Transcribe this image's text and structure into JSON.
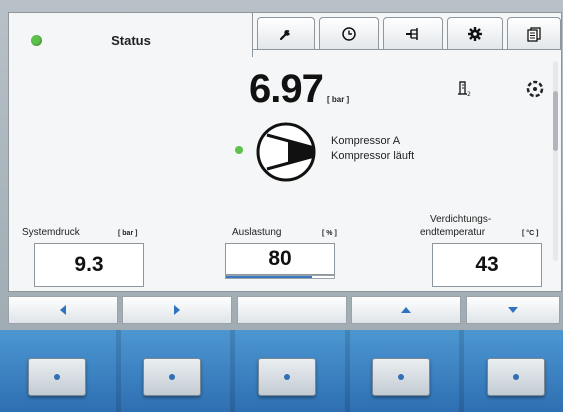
{
  "tabs": {
    "active": {
      "label": "Status",
      "indicator": "green-led"
    },
    "icons": [
      "wrench-icon",
      "clock-icon",
      "network-icon",
      "gear-icon",
      "documents-icon"
    ]
  },
  "main": {
    "pressure_value": "6.97",
    "pressure_unit": "[ bar ]",
    "compressor_name": "Kompressor A",
    "compressor_status": "Kompressor läuft"
  },
  "values": {
    "system_pressure": {
      "label": "Systemdruck",
      "unit": "[ bar ]",
      "value": "9.3"
    },
    "load": {
      "label": "Auslastung",
      "unit": "[ % ]",
      "value": "80",
      "progress_fraction": 0.8
    },
    "temperature": {
      "label_line1": "Verdichtungs-",
      "label_line2": "endtemperatur",
      "unit": "[ °C ]",
      "value": "43"
    }
  },
  "softkeys": [
    "arrow-left-icon",
    "arrow-right-icon",
    "blank",
    "arrow-up-icon",
    "arrow-down-icon"
  ],
  "colors": {
    "accent_blue": "#2e6fb2",
    "status_green": "#5cc24a"
  }
}
